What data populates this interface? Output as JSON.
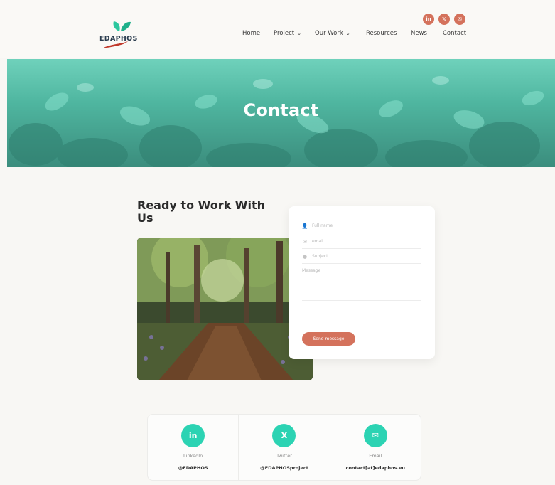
{
  "brand": {
    "name": "EDAPHOS"
  },
  "social_top": [
    {
      "icon": "linkedin-icon",
      "glyph": "in"
    },
    {
      "icon": "x-icon",
      "glyph": "𝕏"
    },
    {
      "icon": "mail-icon",
      "glyph": "✉"
    }
  ],
  "nav": {
    "home": "Home",
    "project": "Project",
    "our_work": "Our Work",
    "resources": "Resources",
    "news": "News",
    "contact": "Contact"
  },
  "hero": {
    "title": "Contact"
  },
  "main": {
    "heading": "Ready to Work With Us"
  },
  "form": {
    "fullname_placeholder": "Full name",
    "email_placeholder": "email",
    "subject_placeholder": "Subject",
    "message_placeholder": "Message",
    "send_label": "Send message"
  },
  "contacts": [
    {
      "icon": "linkedin-icon",
      "glyph": "in",
      "label": "LinkedIn",
      "value": "@EDAPHOS"
    },
    {
      "icon": "x-icon",
      "glyph": "X",
      "label": "Twitter",
      "value": "@EDAPHOSproject"
    },
    {
      "icon": "mail-icon",
      "glyph": "✉",
      "label": "Email",
      "value": "contact[at]edaphos.eu"
    }
  ],
  "colors": {
    "accent": "#d4725c",
    "teal": "#2cd3b3",
    "hero": "#4fb6a0"
  }
}
